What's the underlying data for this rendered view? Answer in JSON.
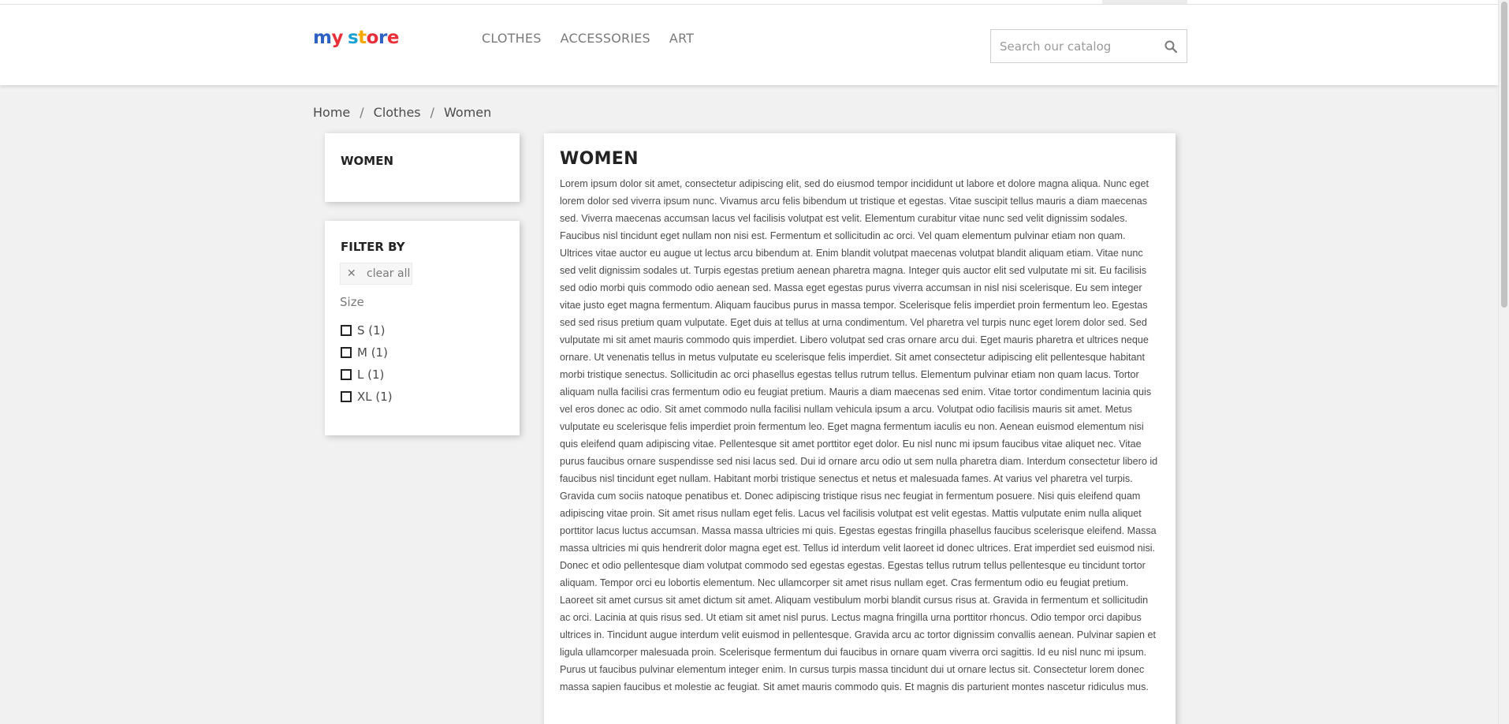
{
  "header": {
    "logo_letters": [
      {
        "char": "m",
        "color": "#2f61c4"
      },
      {
        "char": "y",
        "color": "#e8303b"
      },
      {
        "char": " ",
        "color": "#232323"
      },
      {
        "char": "s",
        "color": "#1ba2d3"
      },
      {
        "char": "t",
        "color": "#f6a700"
      },
      {
        "char": "o",
        "color": "#e8303b"
      },
      {
        "char": "r",
        "color": "#2f61c4"
      },
      {
        "char": "e",
        "color": "#e8303b"
      }
    ],
    "nav": [
      {
        "label": "CLOTHES"
      },
      {
        "label": "ACCESSORIES"
      },
      {
        "label": "ART"
      }
    ],
    "search": {
      "placeholder": "Search our catalog",
      "icon": "search-icon"
    }
  },
  "breadcrumb": [
    {
      "label": "Home"
    },
    {
      "label": "Clothes"
    },
    {
      "label": "Women"
    }
  ],
  "breadcrumb_separator": "/",
  "sidebar": {
    "category_title": "WOMEN",
    "filter": {
      "title": "FILTER BY",
      "clear_icon": "close-icon",
      "clear_label": "clear all",
      "facet_label": "Size",
      "options": [
        {
          "label": "S (1)",
          "checked": false
        },
        {
          "label": "M (1)",
          "checked": false
        },
        {
          "label": "L (1)",
          "checked": false
        },
        {
          "label": "XL (1)",
          "checked": false
        }
      ]
    }
  },
  "main": {
    "title": "WOMEN",
    "description": "Lorem ipsum dolor sit amet, consectetur adipiscing elit, sed do eiusmod tempor incididunt ut labore et dolore magna aliqua. Nunc eget lorem dolor sed viverra ipsum nunc. Vivamus arcu felis bibendum ut tristique et egestas. Vitae suscipit tellus mauris a diam maecenas sed. Viverra maecenas accumsan lacus vel facilisis volutpat est velit. Elementum curabitur vitae nunc sed velit dignissim sodales. Faucibus nisl tincidunt eget nullam non nisi est. Fermentum et sollicitudin ac orci. Vel quam elementum pulvinar etiam non quam. Ultrices vitae auctor eu augue ut lectus arcu bibendum at. Enim blandit volutpat maecenas volutpat blandit aliquam etiam. Vitae nunc sed velit dignissim sodales ut. Turpis egestas pretium aenean pharetra magna. Integer quis auctor elit sed vulputate mi sit. Eu facilisis sed odio morbi quis commodo odio aenean sed. Massa eget egestas purus viverra accumsan in nisl nisi scelerisque. Eu sem integer vitae justo eget magna fermentum. Aliquam faucibus purus in massa tempor. Scelerisque felis imperdiet proin fermentum leo. Egestas sed sed risus pretium quam vulputate. Eget duis at tellus at urna condimentum. Vel pharetra vel turpis nunc eget lorem dolor sed. Sed vulputate mi sit amet mauris commodo quis imperdiet. Libero volutpat sed cras ornare arcu dui. Eget mauris pharetra et ultrices neque ornare. Ut venenatis tellus in metus vulputate eu scelerisque felis imperdiet. Sit amet consectetur adipiscing elit pellentesque habitant morbi tristique senectus. Sollicitudin ac orci phasellus egestas tellus rutrum tellus. Elementum pulvinar etiam non quam lacus. Tortor aliquam nulla facilisi cras fermentum odio eu feugiat pretium. Mauris a diam maecenas sed enim. Vitae tortor condimentum lacinia quis vel eros donec ac odio. Sit amet commodo nulla facilisi nullam vehicula ipsum a arcu. Volutpat odio facilisis mauris sit amet. Metus vulputate eu scelerisque felis imperdiet proin fermentum leo. Eget magna fermentum iaculis eu non. Aenean euismod elementum nisi quis eleifend quam adipiscing vitae. Pellentesque sit amet porttitor eget dolor. Eu nisl nunc mi ipsum faucibus vitae aliquet nec. Vitae purus faucibus ornare suspendisse sed nisi lacus sed. Dui id ornare arcu odio ut sem nulla pharetra diam. Interdum consectetur libero id faucibus nisl tincidunt eget nullam. Habitant morbi tristique senectus et netus et malesuada fames. At varius vel pharetra vel turpis. Gravida cum sociis natoque penatibus et. Donec adipiscing tristique risus nec feugiat in fermentum posuere. Nisi quis eleifend quam adipiscing vitae proin. Sit amet risus nullam eget felis. Lacus vel facilisis volutpat est velit egestas. Mattis vulputate enim nulla aliquet porttitor lacus luctus accumsan. Massa massa ultricies mi quis. Egestas egestas fringilla phasellus faucibus scelerisque eleifend. Massa massa ultricies mi quis hendrerit dolor magna eget est. Tellus id interdum velit laoreet id donec ultrices. Erat imperdiet sed euismod nisi. Donec et odio pellentesque diam volutpat commodo sed egestas egestas. Egestas tellus rutrum tellus pellentesque eu tincidunt tortor aliquam. Tempor orci eu lobortis elementum. Nec ullamcorper sit amet risus nullam eget. Cras fermentum odio eu feugiat pretium. Laoreet sit amet cursus sit amet dictum sit amet. Aliquam vestibulum morbi blandit cursus risus at. Gravida in fermentum et sollicitudin ac orci. Lacinia at quis risus sed. Ut etiam sit amet nisl purus. Lectus magna fringilla urna porttitor rhoncus. Odio tempor orci dapibus ultrices in. Tincidunt augue interdum velit euismod in pellentesque. Gravida arcu ac tortor dignissim convallis aenean. Pulvinar sapien et ligula ullamcorper malesuada proin. Scelerisque fermentum dui faucibus in ornare quam viverra orci sagittis. Id eu nisl nunc mi ipsum. Purus ut faucibus pulvinar elementum integer enim. In cursus turpis massa tincidunt dui ut ornare lectus sit. Consectetur lorem donec massa sapien faucibus et molestie ac feugiat. Sit amet mauris commodo quis. Et magnis dis parturient montes nascetur ridiculus mus."
  },
  "colors": {
    "page_background": "#f1f1f1",
    "text_dark": "#232323",
    "text_muted": "#7a7a7a"
  }
}
